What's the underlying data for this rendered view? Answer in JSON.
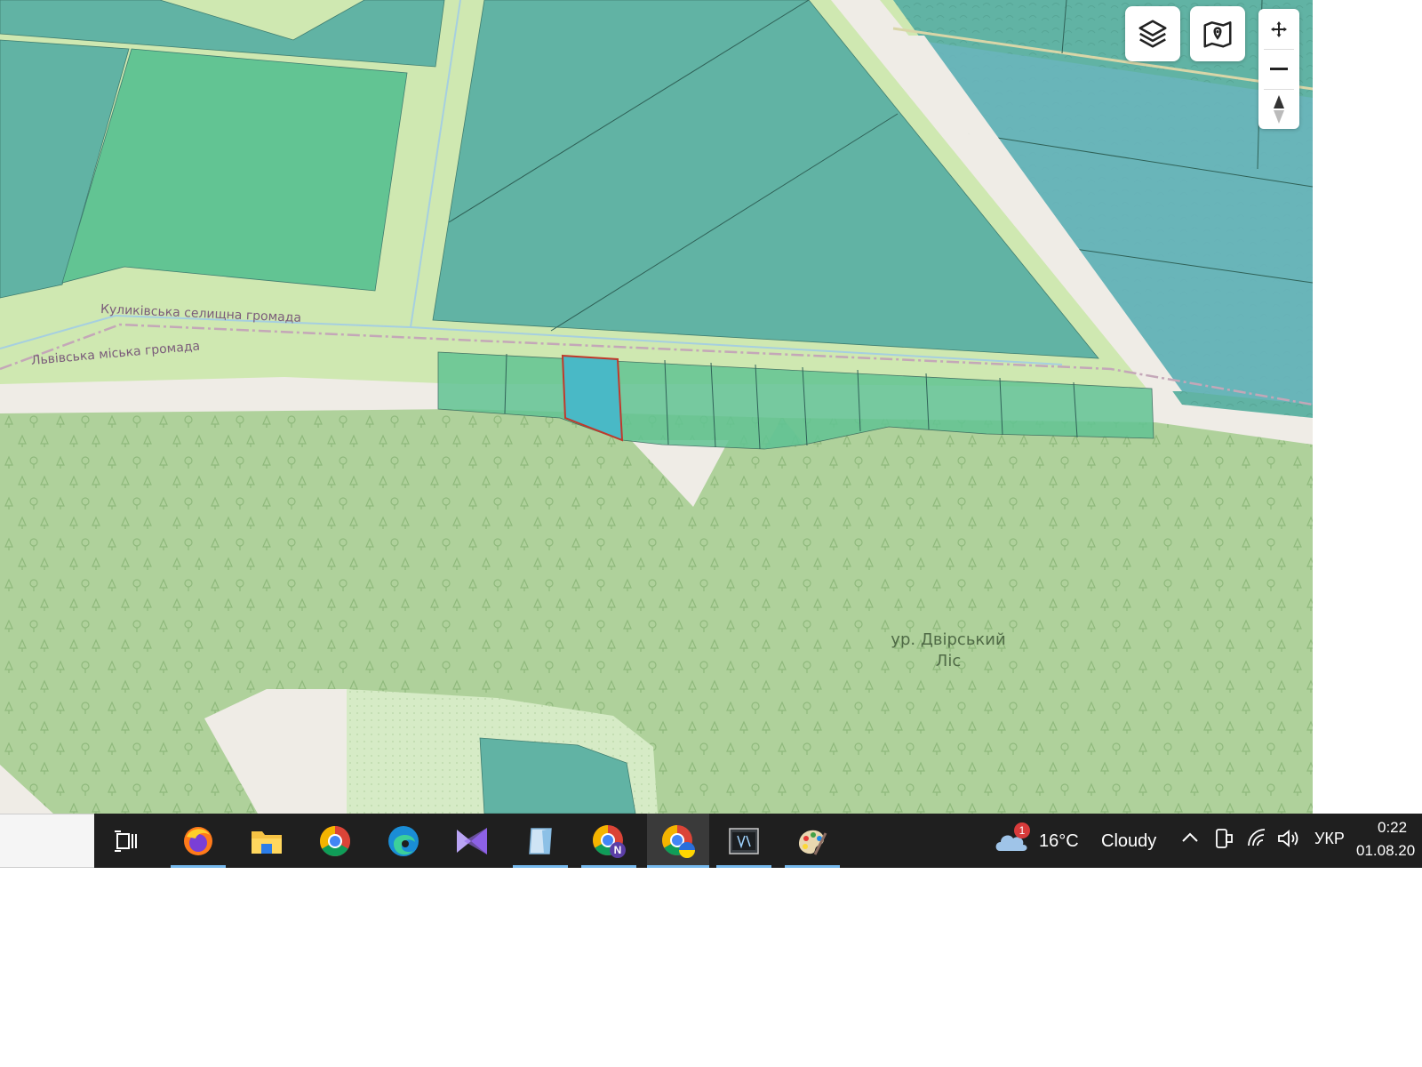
{
  "map": {
    "labels": {
      "community_kulykiv": "Куликівська селищна громада",
      "community_lviv": "Львівська міська громада",
      "forest_line1": "ур. Двірський",
      "forest_line2": "Ліс"
    },
    "controls": {
      "layers_icon": "layers-icon",
      "map_pin_icon": "map-pin-icon",
      "zoom_in_icon": "plus-move-icon",
      "zoom_out_icon": "minus-icon",
      "compass_icon": "north-arrow-icon"
    },
    "colors": {
      "agri_dark": "#61b3a4",
      "agri_green": "#62c493",
      "grass": "#cfe8b1",
      "forest": "#afd19b",
      "road": "#efece6",
      "selected_outline": "#c0392b",
      "selected_fill": "#49b9c6"
    }
  },
  "taskbar": {
    "apps": [
      {
        "name": "task-view-icon",
        "active": false,
        "running": false
      },
      {
        "name": "firefox-icon",
        "active": false,
        "running": true
      },
      {
        "name": "file-explorer-icon",
        "active": false,
        "running": false
      },
      {
        "name": "chrome-icon",
        "active": false,
        "running": false
      },
      {
        "name": "edge-icon",
        "active": false,
        "running": false
      },
      {
        "name": "visual-studio-icon",
        "active": false,
        "running": false
      },
      {
        "name": "notes-app-icon",
        "active": false,
        "running": true
      },
      {
        "name": "chrome-profile-n-icon",
        "active": false,
        "running": true
      },
      {
        "name": "chrome-profile-ukraine-icon",
        "active": true,
        "running": true
      },
      {
        "name": "terminal-app-icon",
        "active": false,
        "running": true
      },
      {
        "name": "paint-app-icon",
        "active": false,
        "running": true
      }
    ],
    "weather": {
      "temperature": "16°C",
      "condition": "Cloudy",
      "badge_count": "1"
    },
    "tray": {
      "language": "УКР",
      "time": "0:22",
      "date": "01.08.20"
    }
  }
}
